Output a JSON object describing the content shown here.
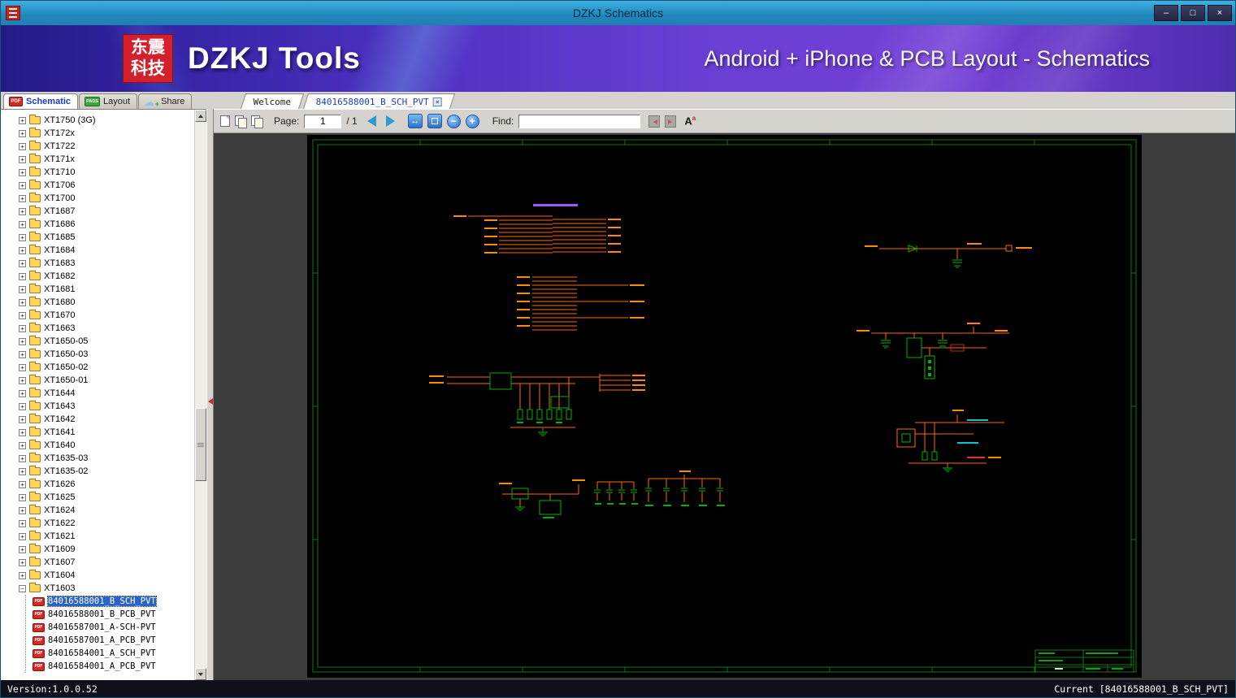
{
  "window": {
    "title": "DZKJ Schematics",
    "controls": {
      "minimize": "–",
      "maximize": "□",
      "close": "×"
    }
  },
  "banner": {
    "logo_line1": "东震",
    "logo_line2": "科技",
    "app_name": "DZKJ Tools",
    "subtitle": "Android + iPhone & PCB Layout - Schematics"
  },
  "mode_tabs": [
    {
      "label": "Schematic",
      "icon": "pdf-icon",
      "badge": "PDF",
      "active": true
    },
    {
      "label": "Layout",
      "icon": "pads-icon",
      "badge": "PADS",
      "active": false
    },
    {
      "label": "Share",
      "icon": "cloud-share-icon",
      "badge": "☁",
      "active": false
    }
  ],
  "doc_tabs": [
    {
      "label": "Welcome",
      "active": false,
      "closable": false
    },
    {
      "label": "84016588001_B_SCH_PVT",
      "active": true,
      "closable": true
    }
  ],
  "sidebar": {
    "folders": [
      "XT1750 (3G)",
      "XT172x",
      "XT1722",
      "XT171x",
      "XT1710",
      "XT1706",
      "XT1700",
      "XT1687",
      "XT1686",
      "XT1685",
      "XT1684",
      "XT1683",
      "XT1682",
      "XT1681",
      "XT1680",
      "XT1670",
      "XT1663",
      "XT1650-05",
      "XT1650-03",
      "XT1650-02",
      "XT1650-01",
      "XT1644",
      "XT1643",
      "XT1642",
      "XT1641",
      "XT1640",
      "XT1635-03",
      "XT1635-02",
      "XT1626",
      "XT1625",
      "XT1624",
      "XT1622",
      "XT1621",
      "XT1609",
      "XT1607",
      "XT1604"
    ],
    "expanded_folder": "XT1603",
    "files": [
      {
        "label": "84016588001_B_SCH_PVT",
        "selected": true
      },
      {
        "label": "84016588001_B_PCB_PVT",
        "selected": false
      },
      {
        "label": "84016587001_A-SCH-PVT",
        "selected": false
      },
      {
        "label": "84016587001_A_PCB_PVT",
        "selected": false
      },
      {
        "label": "84016584001_A_SCH_PVT",
        "selected": false
      },
      {
        "label": "84016584001_A_PCB_PVT",
        "selected": false
      }
    ]
  },
  "toolbar": {
    "page_label": "Page:",
    "page_value": "1",
    "page_total": "/ 1",
    "find_label": "Find:",
    "find_value": ""
  },
  "statusbar": {
    "version": "Version:1.0.0.52",
    "current": "Current [84016588001_B_SCH_PVT]"
  },
  "colors": {
    "titlebar": "#2e9ad0",
    "selection": "#2a63c8",
    "schematic_frame": "#0e7a0e",
    "schematic_trace": "#ff6a00",
    "schematic_component": "#00b000",
    "schematic_label": "#ff8a00",
    "schematic_title_text": "#9b59ff"
  }
}
